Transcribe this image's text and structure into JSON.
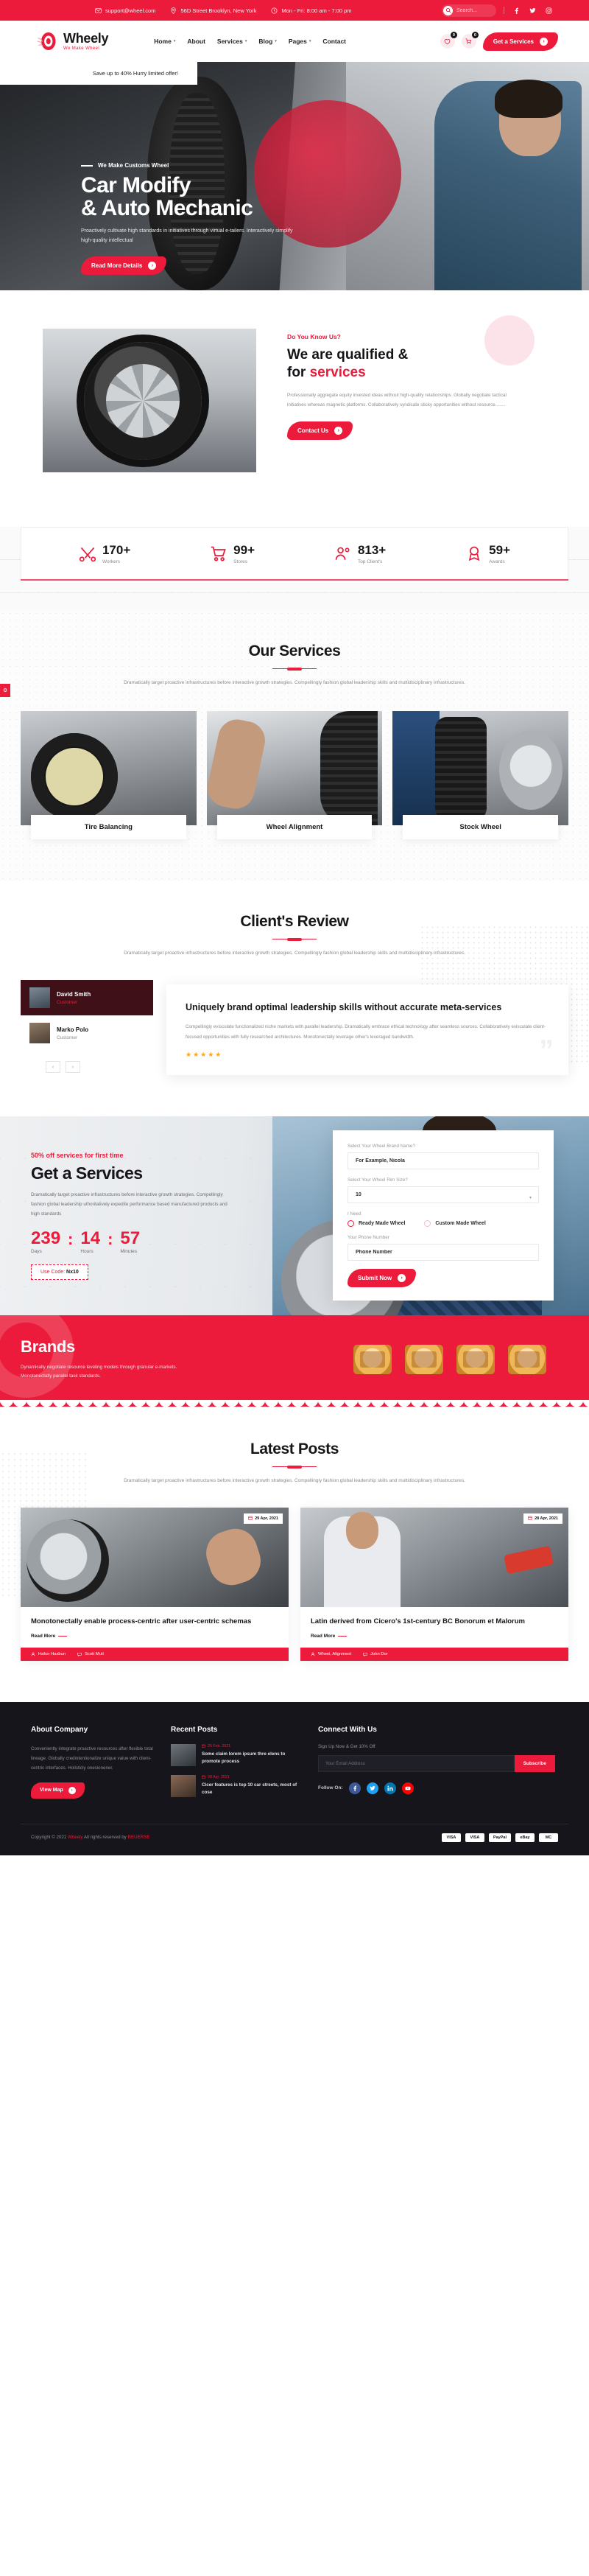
{
  "topbar": {
    "email": "support@wheel.com",
    "address": "56D Street Brooklyn, New York",
    "hours": "Mon - Fri: 8:00 am - 7:00 pm",
    "search_placeholder": "Search...",
    "socials": [
      "f",
      "t",
      "in"
    ]
  },
  "header": {
    "logo_name": "Wheely",
    "logo_tagline": "We Make Wheel",
    "nav": [
      {
        "label": "Home",
        "caret": "▾"
      },
      {
        "label": "About",
        "caret": ""
      },
      {
        "label": "Services",
        "caret": "▾"
      },
      {
        "label": "Blog",
        "caret": "▾"
      },
      {
        "label": "Pages",
        "caret": "▾"
      },
      {
        "label": "Contact",
        "caret": ""
      }
    ],
    "wishlist_count": "0",
    "cart_count": "0",
    "cta": "Get a Services",
    "cta_arrow": "›"
  },
  "hero": {
    "offer": "Save up to 40% Hurry limited offer!",
    "kicker": "We Make Customs Wheel",
    "title_line1": "Car Modify",
    "title_line2": "& Auto Mechanic",
    "paragraph": "Proactively cultivate high standards in initiatives through virtual e-tailers. Interactively simplify high-quality intellectual",
    "button": "Read More Details",
    "button_arrow": "›"
  },
  "about": {
    "kicker": "Do You Know Us?",
    "heading_line1": "We are qualified &",
    "heading_line2_plain": "for ",
    "heading_line2_red": "services",
    "paragraph": "Professionally aggregate equity invested ideas without high-quality relationships. Globally negotiate tactical initiatives whereas magnetic platforms. Collaboratively syndicate sticky opportunities without resource........",
    "button": "Contact Us",
    "button_arrow": "›"
  },
  "counters": [
    {
      "icon": "tools-icon",
      "number": "170+",
      "label": "Workers"
    },
    {
      "icon": "cart-icon",
      "number": "99+",
      "label": "Stores"
    },
    {
      "icon": "users-icon",
      "number": "813+",
      "label": "Top Client's"
    },
    {
      "icon": "award-icon",
      "number": "59+",
      "label": "Awards"
    }
  ],
  "services": {
    "title": "Our Services",
    "description": "Dramatically target proactive infrastructures before interactive growth strategies. Compellingly fashion global leadership skills and multidisciplinary infrastructures.",
    "side_tab": "⚙",
    "cards": [
      {
        "title": "Tire Balancing"
      },
      {
        "title": "Wheel Alignment"
      },
      {
        "title": "Stock Wheel"
      }
    ]
  },
  "reviews": {
    "title": "Client's Review",
    "description": "Dramatically target proactive infrastructures before interactive growth strategies. Compellingly fashion global leadership skills and multidisciplinary infrastructures.",
    "people": [
      {
        "name": "David Smith",
        "role": "Customer",
        "active": true
      },
      {
        "name": "Marko Polo",
        "role": "Customer",
        "active": false
      }
    ],
    "quote_title": "Uniquely brand optimal leadership skills without accurate meta-services",
    "quote_text": "Compellingly evisculate functionalized niche markets with parallel leadership. Dramatically embrace ethical technology after seamless sources. Collaboratively evisculate client-focused opportunities with fully researched architectures. Monotonectally leverage other's leveraged bandwidth.",
    "stars": "★★★★★",
    "quote_mark": "”",
    "prev_arrow": "‹",
    "next_arrow": "›"
  },
  "get_service": {
    "kicker": "50% off services for first time",
    "heading": "Get a Services",
    "paragraph": "Dramatically target proactive infrastructures before interactive growth strategies. Compellingly fashion global leadership uthoritatively expedite performance based manufactured products and high standards",
    "countdown": [
      {
        "value": "239",
        "label": "Days"
      },
      {
        "value": "14",
        "label": "Hours"
      },
      {
        "value": "57",
        "label": "Minutes"
      }
    ],
    "colon": ":",
    "code_prefix": "Use Code: ",
    "code_value": "Nx10",
    "form": {
      "brand_label": "Select Your Wheel Brand Name?",
      "brand_placeholder": "For Example, Nicola",
      "rim_label": "Select Your Wheel Rim Size?",
      "rim_value": "10",
      "rim_caret": "▾",
      "need_label": "I Need",
      "option_ready": "Ready Made Wheel",
      "option_custom": "Custom Made Wheel",
      "phone_label": "Your Phone Number",
      "phone_placeholder": "Phone Number",
      "submit": "Submit Now",
      "submit_arrow": "›"
    }
  },
  "brands": {
    "heading": "Brands",
    "paragraph": "Dynamically negotiate resource leveling models through granular e-markets. Monotonectally parallel task standards.",
    "logos": [
      "brand-logo-1",
      "brand-logo-2",
      "brand-logo-3",
      "brand-logo-4"
    ]
  },
  "posts": {
    "title": "Latest Posts",
    "description": "Dramatically target proactive infrastructures before interactive growth strategies. Compellingly fashion global leadership skills and multidisciplinary infrastructures.",
    "items": [
      {
        "date": "29 Apr, 2021",
        "title": "Monotonectally enable process-centric after user-centric schemas",
        "read_more": "Read More",
        "author": "Hafun Hasbun",
        "comments": "Scott Muti"
      },
      {
        "date": "28 Apr, 2021",
        "title": "Latin derived from Cicero's 1st-century BC Bonorum et Malorum",
        "read_more": "Read More",
        "author": "Wheel, Alignment",
        "comments": "John Dor"
      }
    ]
  },
  "footer": {
    "about_heading": "About Company",
    "about_text": "Conveniently integrate proactive resources after flexible total lineage. Globally credintentionalize unique value with client-centric interfaces. Holisticly onesionener.",
    "about_button": "View Map",
    "about_button_arrow": "›",
    "recent_heading": "Recent Posts",
    "recent_posts": [
      {
        "date": "25 Feb, 2021",
        "title": "Some claim lorem ipsum thre elens to promote process"
      },
      {
        "date": "08 Apr, 2021",
        "title": "Cicer features is top 10 car streets, most of cose"
      }
    ],
    "connect_heading": "Connect With Us",
    "subscribe_label": "Sign Up Now & Get 10% Off",
    "subscribe_placeholder": "Your Email Address",
    "subscribe_button": "Subscribe",
    "follow_label": "Follow On:",
    "socials": [
      "f",
      "t",
      "in",
      "yt"
    ],
    "copyright_prefix": "Copyright © 2021 ",
    "copyright_brand": "Wheely",
    "copyright_mid": " All rights reserved by ",
    "copyright_author": "REUERSE",
    "payments": [
      "VISA",
      "VISA",
      "PayPal",
      "eBay",
      "MC"
    ]
  }
}
